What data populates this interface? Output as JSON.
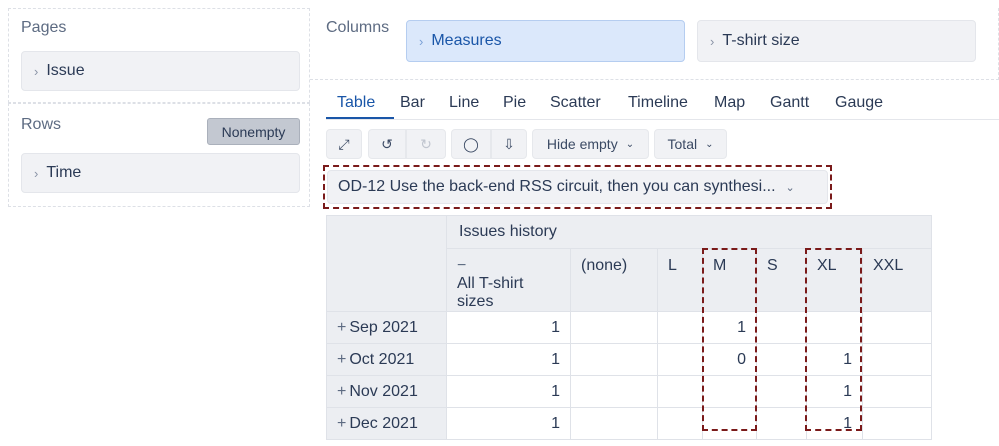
{
  "pages": {
    "label": "Pages",
    "items": [
      "Issue"
    ]
  },
  "rows": {
    "label": "Rows",
    "nonempty": "Nonempty",
    "items": [
      "Time"
    ]
  },
  "columns": {
    "label": "Columns",
    "items": [
      "Measures",
      "T-shirt size"
    ]
  },
  "tabs": [
    "Table",
    "Bar",
    "Line",
    "Pie",
    "Scatter",
    "Timeline",
    "Map",
    "Gantt",
    "Gauge"
  ],
  "active_tab": "Table",
  "toolbar": {
    "hide_empty": "Hide empty",
    "total": "Total"
  },
  "filter": {
    "value": "OD-12 Use the back-end RSS circuit, then you can synthesi..."
  },
  "table": {
    "measure": "Issues history",
    "columns": [
      "All T-shirt sizes",
      "(none)",
      "L",
      "M",
      "S",
      "XL",
      "XXL"
    ],
    "rows": [
      {
        "label": "Sep 2021",
        "values": [
          "1",
          "",
          "",
          "1",
          "",
          "",
          ""
        ]
      },
      {
        "label": "Oct 2021",
        "values": [
          "1",
          "",
          "",
          "0",
          "",
          "1",
          ""
        ]
      },
      {
        "label": "Nov 2021",
        "values": [
          "1",
          "",
          "",
          "",
          "",
          "1",
          ""
        ]
      },
      {
        "label": "Dec 2021",
        "values": [
          "1",
          "",
          "",
          "",
          "",
          "1",
          ""
        ]
      }
    ]
  },
  "colors": {
    "accent": "#1a56a8",
    "highlight": "#7a1a1a"
  }
}
